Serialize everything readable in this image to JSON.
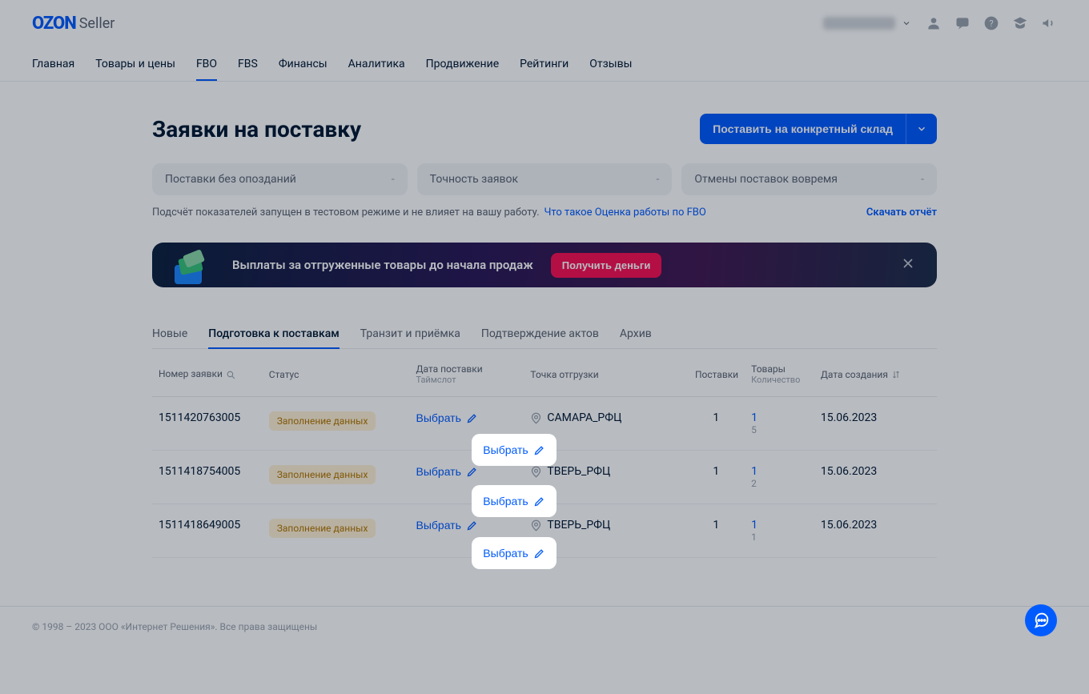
{
  "logo": {
    "brand": "OZON",
    "sub": "Seller"
  },
  "nav": [
    "Главная",
    "Товары и цены",
    "FBO",
    "FBS",
    "Финансы",
    "Аналитика",
    "Продвижение",
    "Рейтинги",
    "Отзывы"
  ],
  "nav_active": 2,
  "page": {
    "title": "Заявки на поставку",
    "cta": "Поставить на конкретный склад"
  },
  "stats": [
    {
      "label": "Поставки без опозданий",
      "value": "-"
    },
    {
      "label": "Точность заявок",
      "value": "-"
    },
    {
      "label": "Отмены поставок вовремя",
      "value": "-"
    }
  ],
  "info": {
    "text": "Подсчёт показателей запущен в тестовом режиме и не влияет на вашу работу.",
    "link": "Что такое Оценка работы по FBO",
    "download": "Скачать отчёт"
  },
  "banner": {
    "text": "Выплаты за отгруженные товары до начала продаж",
    "btn": "Получить деньги"
  },
  "tabs": [
    "Новые",
    "Подготовка к поставкам",
    "Транзит и приёмка",
    "Подтверждение актов",
    "Архив"
  ],
  "tabs_active": 1,
  "columns": {
    "id": "Номер заявки",
    "status": "Статус",
    "date": "Дата поставки",
    "date_sub": "Таймслот",
    "loc": "Точка отгрузки",
    "deliv": "Поставки",
    "goods": "Товары",
    "goods_sub": "Количество",
    "created": "Дата создания"
  },
  "select_label": "Выбрать",
  "status_label": "Заполнение данных",
  "rows": [
    {
      "id": "1511420763005",
      "loc": "САМАРА_РФЦ",
      "deliv": "1",
      "goods": "1",
      "goods_sub": "5",
      "created": "15.06.2023"
    },
    {
      "id": "1511418754005",
      "loc": "ТВЕРЬ_РФЦ",
      "deliv": "1",
      "goods": "1",
      "goods_sub": "2",
      "created": "15.06.2023"
    },
    {
      "id": "1511418649005",
      "loc": "ТВЕРЬ_РФЦ",
      "deliv": "1",
      "goods": "1",
      "goods_sub": "1",
      "created": "15.06.2023"
    }
  ],
  "footer": "© 1998 – 2023 ООО «Интернет Решения». Все права защищены"
}
